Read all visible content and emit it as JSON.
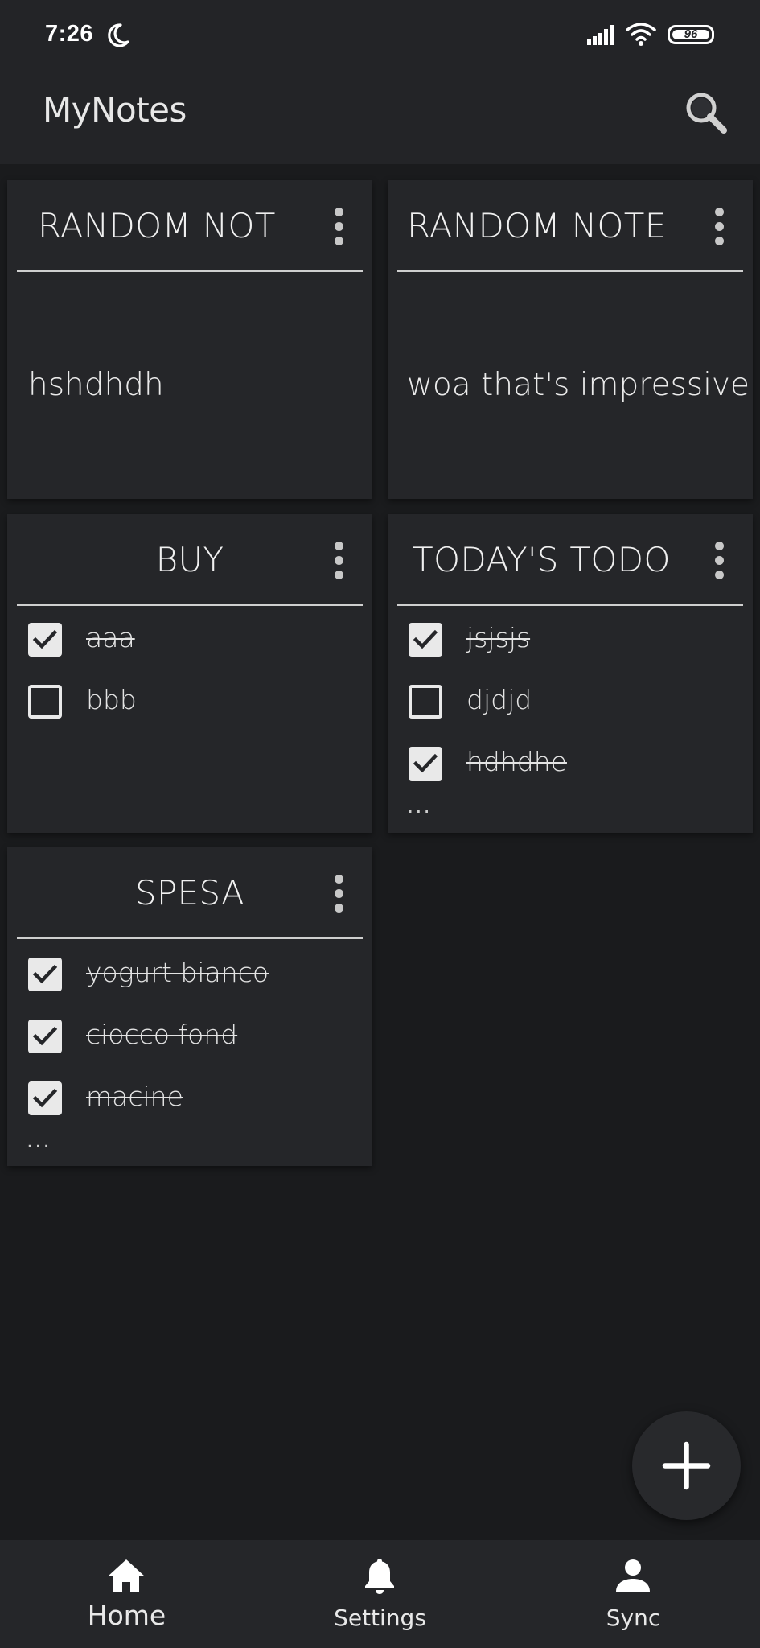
{
  "status_bar": {
    "time": "7:26",
    "battery_level": "96"
  },
  "app_bar": {
    "title": "MyNotes",
    "search_icon": "search-icon"
  },
  "notes": [
    {
      "title": "RANDOM NOT",
      "type": "text",
      "body": "hshdhdh"
    },
    {
      "title": "RANDOM NOTE",
      "type": "text",
      "body": "woa that's impressive"
    },
    {
      "title": "BUY",
      "type": "checklist",
      "items": [
        {
          "label": "aaa",
          "checked": true
        },
        {
          "label": "bbb",
          "checked": false
        }
      ]
    },
    {
      "title": "TODAY'S TODO",
      "type": "checklist",
      "more": "...",
      "items": [
        {
          "label": "jsjsjs",
          "checked": true
        },
        {
          "label": "djdjd",
          "checked": false
        },
        {
          "label": "hdhdhe",
          "checked": true
        }
      ]
    },
    {
      "title": "SPESA",
      "type": "checklist",
      "more": "...",
      "items": [
        {
          "label": "yogurt bianco",
          "checked": true
        },
        {
          "label": "ciocco fond",
          "checked": true
        },
        {
          "label": "macine",
          "checked": true
        }
      ]
    }
  ],
  "fab": {
    "icon": "plus-icon"
  },
  "bottom_nav": [
    {
      "label": "Home",
      "icon": "home-icon",
      "active": true
    },
    {
      "label": "Settings",
      "icon": "bell-icon",
      "active": false
    },
    {
      "label": "Sync",
      "icon": "person-icon",
      "active": false
    }
  ],
  "colors": {
    "background": "#1a1b1d",
    "surface": "#252629",
    "bar": "#232427",
    "text": "#e6e6e6"
  }
}
